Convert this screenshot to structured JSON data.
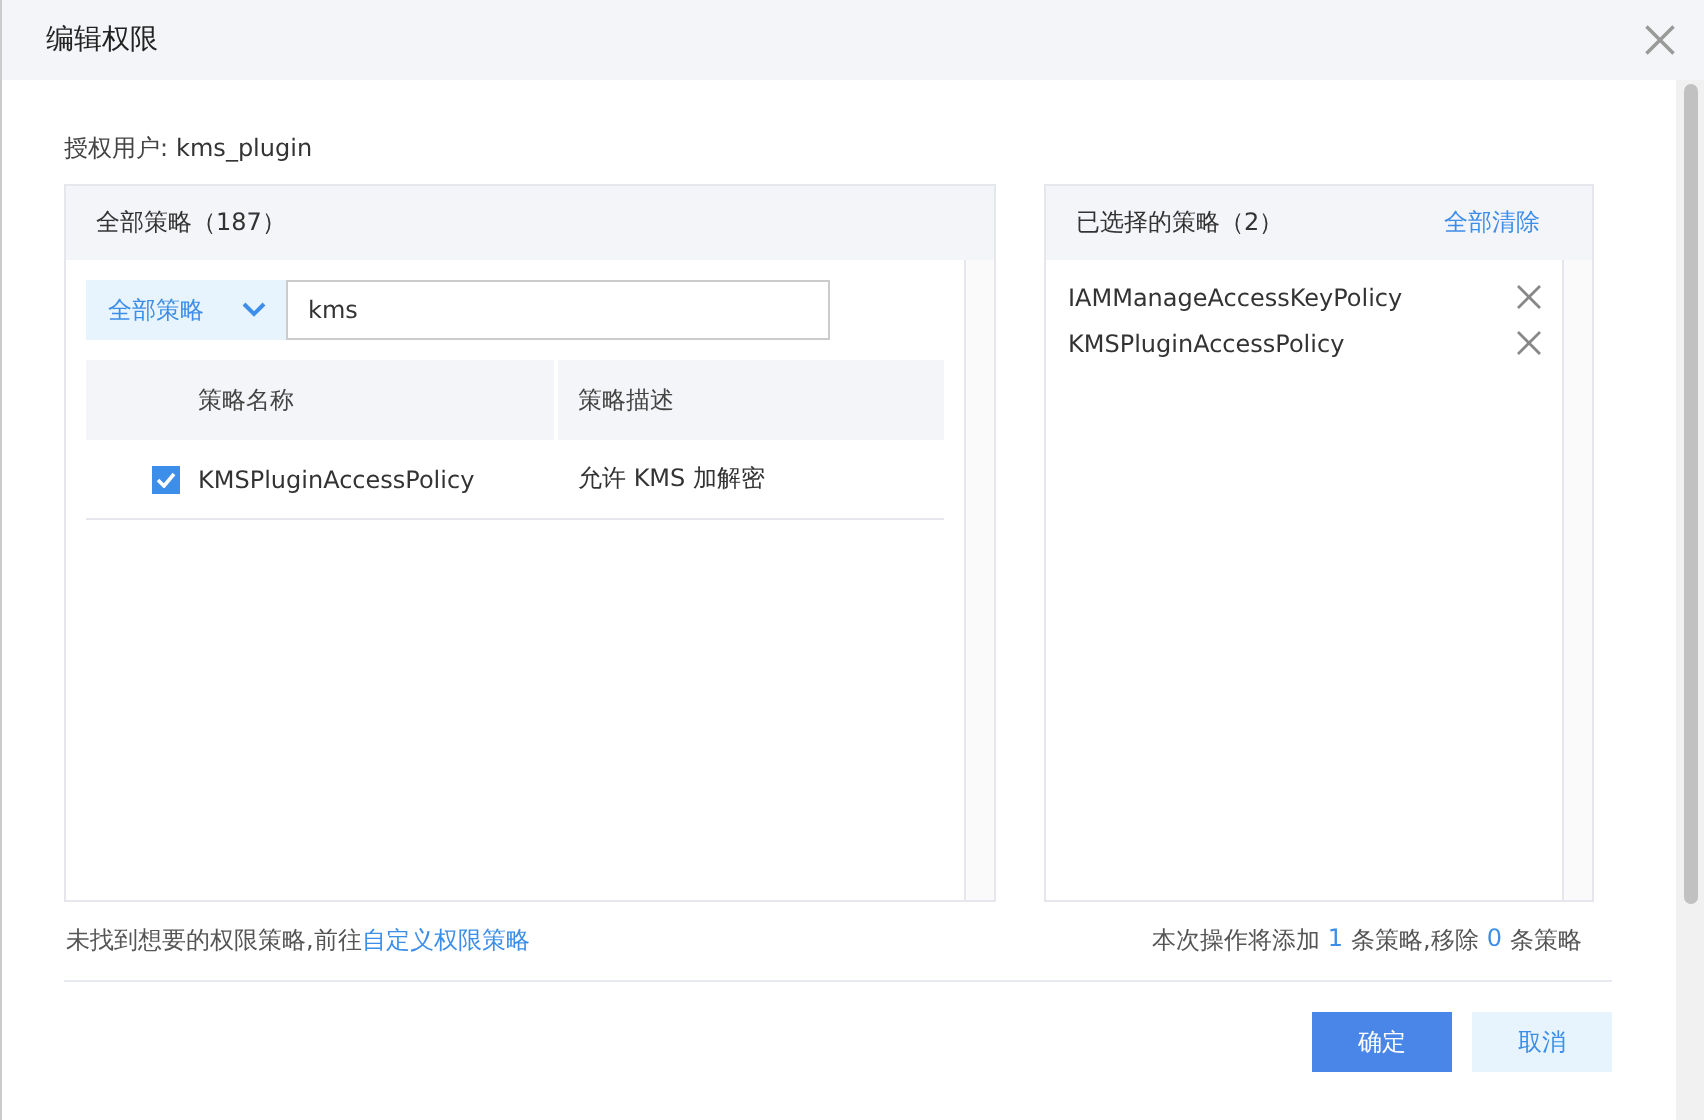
{
  "window": {
    "title": "编辑权限"
  },
  "user": {
    "label": "授权用户:",
    "value": "kms_plugin"
  },
  "all_policies": {
    "title": "全部策略（187）",
    "filter": "全部策略",
    "search": {
      "value": "kms"
    },
    "columns": [
      "策略名称",
      "策略描述"
    ],
    "rows": [
      {
        "name": "KMSPluginAccessPolicy",
        "description": "允许 KMS 加解密",
        "checked": true
      }
    ]
  },
  "selected_policies": {
    "title": "已选择的策略（2）",
    "clear_link": "全部清除",
    "items": [
      "IAMManageAccessKeyPolicy",
      "KMSPluginAccessPolicy"
    ]
  },
  "hint": {
    "text": "未找到想要的权限策略,前往",
    "link": "自定义权限策略"
  },
  "summary": [
    {
      "text": "本次操作将添加",
      "kind": "plain"
    },
    {
      "text": "1",
      "kind": "count"
    },
    {
      "text": "条策略,移除",
      "kind": "plain"
    },
    {
      "text": "0",
      "kind": "count"
    },
    {
      "text": "条策略",
      "kind": "plain"
    }
  ],
  "buttons": [
    {
      "label": "确定",
      "kind": "primary"
    },
    {
      "label": "取消",
      "kind": "secondary"
    }
  ]
}
